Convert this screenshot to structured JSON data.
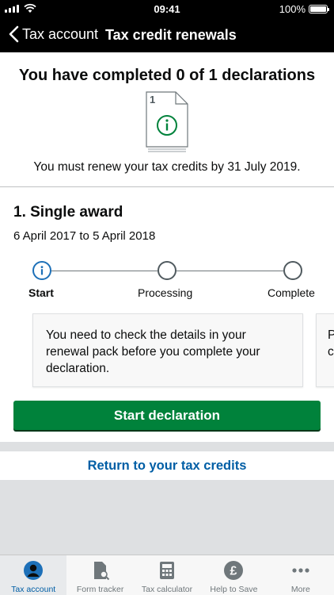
{
  "status_bar": {
    "time": "09:41",
    "battery": "100%"
  },
  "nav": {
    "back_label": "Tax account",
    "title": "Tax credit renewals"
  },
  "summary": {
    "heading": "You have completed 0 of 1 declarations",
    "doc_number": "1",
    "deadline": "You must renew your tax credits by 31 July 2019."
  },
  "award": {
    "title": "1. Single award",
    "dates": "6 April 2017 to 5 April 2018",
    "steps": [
      {
        "label": "Start",
        "active": true
      },
      {
        "label": "Processing",
        "active": false
      },
      {
        "label": "Complete",
        "active": false
      }
    ],
    "card_text": "You need to check the details in your renewal pack before you complete your declaration.",
    "peek_text": "P\nc",
    "button_label": "Start declaration"
  },
  "return_link": "Return to your tax credits",
  "tabs": [
    {
      "label": "Tax account",
      "icon": "person-icon",
      "active": true
    },
    {
      "label": "Form tracker",
      "icon": "form-search-icon",
      "active": false
    },
    {
      "label": "Tax calculator",
      "icon": "calculator-icon",
      "active": false
    },
    {
      "label": "Help to Save",
      "icon": "pound-coin-icon",
      "active": false
    },
    {
      "label": "More",
      "icon": "more-dots-icon",
      "active": false
    }
  ],
  "colors": {
    "brand_green": "#00823b",
    "link_blue": "#005ea5",
    "active_blue": "#1d70b8"
  }
}
